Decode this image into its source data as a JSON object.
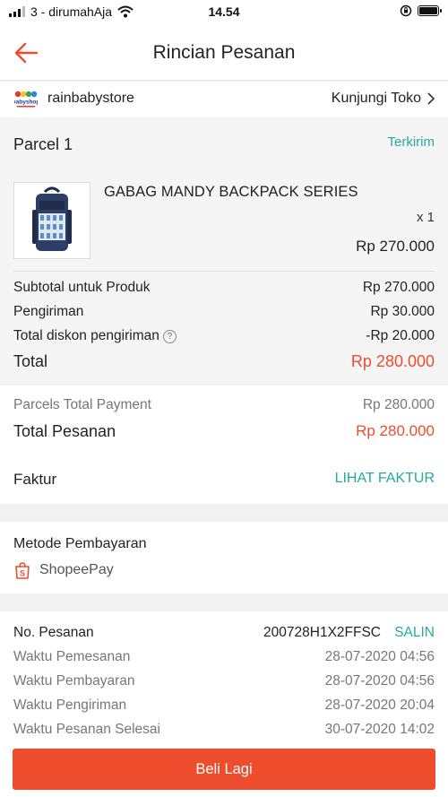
{
  "status_bar": {
    "carrier": "3 - dirumahAja",
    "time": "14.54"
  },
  "header": {
    "title": "Rincian Pesanan",
    "back_icon": "arrow-left-icon"
  },
  "store": {
    "name": "rainbabystore",
    "logo_text": "babyshop",
    "visit_label": "Kunjungi Toko"
  },
  "parcel": {
    "title": "Parcel 1",
    "status": "Terkirim",
    "product": {
      "name": "GABAG MANDY BACKPACK SERIES",
      "qty": "x 1",
      "price": "Rp 270.000"
    },
    "summary": {
      "subtotal_label": "Subtotal untuk Produk",
      "subtotal_value": "Rp 270.000",
      "shipping_label": "Pengiriman",
      "shipping_value": "Rp 30.000",
      "discount_label": "Total diskon pengiriman",
      "discount_value": "-Rp 20.000",
      "total_label": "Total",
      "total_value": "Rp 280.000"
    }
  },
  "payment_totals": {
    "parcels_label": "Parcels Total Payment",
    "parcels_value": "Rp 280.000",
    "order_total_label": "Total Pesanan",
    "order_total_value": "Rp 280.000"
  },
  "invoice": {
    "label": "Faktur",
    "link": "LIHAT FAKTUR"
  },
  "payment_method": {
    "title": "Metode Pembayaran",
    "method": "ShopeePay"
  },
  "order_info": {
    "order_no_label": "No. Pesanan",
    "order_no_value": "200728H1X2FFSC",
    "copy_label": "SALIN",
    "rows": [
      {
        "label": "Waktu Pemesanan",
        "value": "28-07-2020 04:56"
      },
      {
        "label": "Waktu Pembayaran",
        "value": "28-07-2020 04:56"
      },
      {
        "label": "Waktu Pengiriman",
        "value": "28-07-2020 20:04"
      },
      {
        "label": "Waktu Pesanan Selesai",
        "value": "30-07-2020 14:02"
      }
    ]
  },
  "actions": {
    "buy_again": "Beli Lagi"
  },
  "colors": {
    "accent": "#ee4d2d",
    "teal": "#26aa99"
  }
}
